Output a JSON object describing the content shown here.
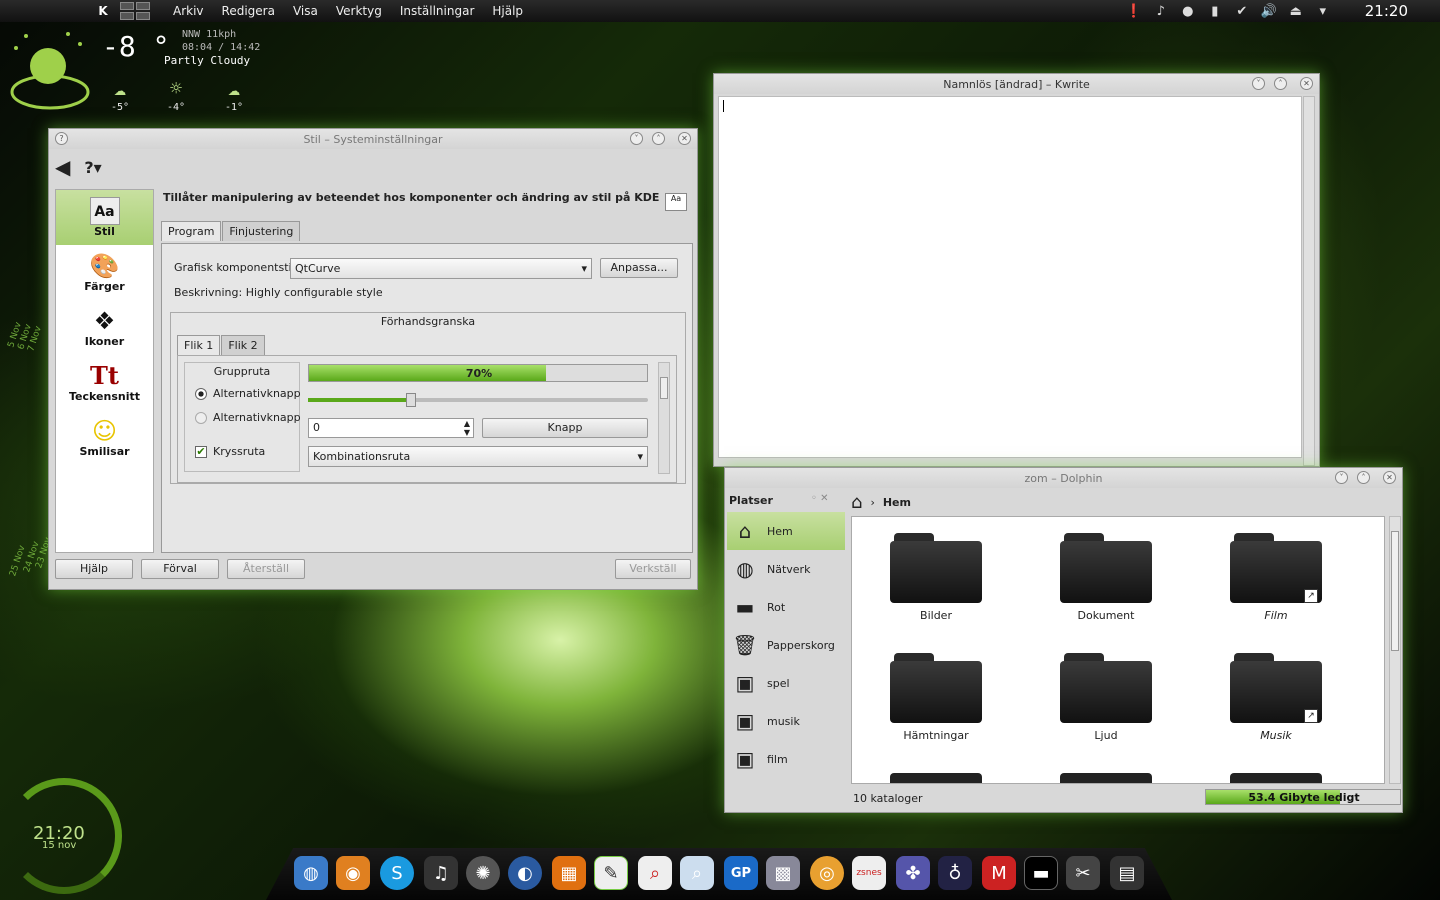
{
  "panel": {
    "menu": [
      "Arkiv",
      "Redigera",
      "Visa",
      "Verktyg",
      "Inställningar",
      "Hjälp"
    ],
    "clock": "21:20"
  },
  "weather": {
    "temp": "-8 °",
    "wind": "NNW 11kph",
    "times": "08:04 / 14:42",
    "condition": "Partly Cloudy",
    "forecast": [
      "-5°",
      "-4°",
      "-1°"
    ]
  },
  "sys": {
    "title": "Stil – Systeminställningar",
    "sidebar": [
      "Stil",
      "Färger",
      "Ikoner",
      "Teckensnitt",
      "Smilisar"
    ],
    "desc": "Tillåter manipulering av beteendet hos komponenter och ändring av stil på KDE",
    "tabs": [
      "Program",
      "Finjustering"
    ],
    "widget_style_label": "Grafisk komponentstil:",
    "widget_style_value": "QtCurve",
    "customize": "Anpassa...",
    "description": "Beskrivning: Highly configurable style",
    "preview": {
      "title": "Förhandsgranska",
      "tabs": [
        "Flik 1",
        "Flik 2"
      ],
      "group": "Gruppruta",
      "radio1": "Alternativknapp",
      "radio2": "Alternativknapp",
      "checkbox": "Kryssruta",
      "progress": "70%",
      "progress_value": 0.7,
      "spin": "0",
      "button": "Knapp",
      "combo": "Kombinationsruta"
    },
    "buttons": {
      "help": "Hjälp",
      "defaults": "Förval",
      "reset": "Återställ",
      "apply": "Verkställ"
    }
  },
  "kwrite": {
    "title": "Namnlös [ändrad] – Kwrite"
  },
  "dolphin": {
    "title": "zom – Dolphin",
    "places_title": "Platser",
    "places": [
      "Hem",
      "Nätverk",
      "Rot",
      "Papperskorg",
      "spel",
      "musik",
      "film"
    ],
    "breadcrumb": "Hem",
    "folders": [
      "Bilder",
      "Dokument",
      "Film",
      "Hämtningar",
      "Ljud",
      "Musik"
    ],
    "status": "10 kataloger",
    "free": "53.4 Gibyte ledigt",
    "free_fraction": 0.69
  },
  "clockwidget": {
    "time": "21:20",
    "date": "15 nov"
  },
  "calendar": [
    "5 Nov",
    "6 Nov",
    "7 Nov",
    "23 Nov",
    "24 Nov",
    "25 Nov"
  ]
}
